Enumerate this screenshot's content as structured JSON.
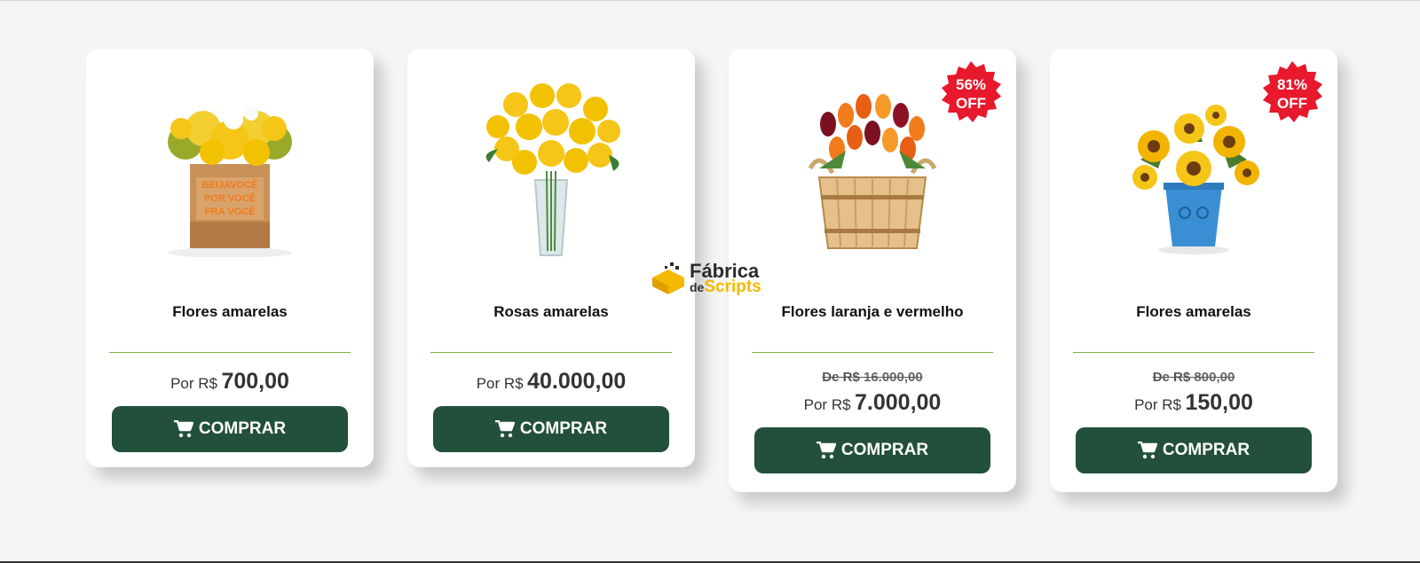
{
  "products": [
    {
      "name": "Flores amarelas",
      "price_label": "Por R$",
      "price": "700,00",
      "button": "COMPRAR"
    },
    {
      "name": "Rosas amarelas",
      "price_label": "Por R$",
      "price": "40.000,00",
      "button": "COMPRAR"
    },
    {
      "name": "Flores laranja e vermelho",
      "old_label": "De R$",
      "old_price": "16.000,00",
      "price_label": "Por R$",
      "price": "7.000,00",
      "button": "COMPRAR",
      "badge_pct": "56%",
      "badge_off": "OFF"
    },
    {
      "name": "Flores amarelas",
      "old_label": "De R$",
      "old_price": "800,00",
      "price_label": "Por R$",
      "price": "150,00",
      "button": "COMPRAR",
      "badge_pct": "81%",
      "badge_off": "OFF"
    }
  ],
  "watermark": {
    "line1": "Fábrica",
    "prefix": "de",
    "line2": "Scripts"
  },
  "colors": {
    "button": "#22503a",
    "divider": "#7cb342",
    "badge": "#e8192c",
    "background": "#f5f5f5"
  },
  "icons": {
    "cart": "shopping-cart-icon",
    "badge": "starburst-badge"
  }
}
